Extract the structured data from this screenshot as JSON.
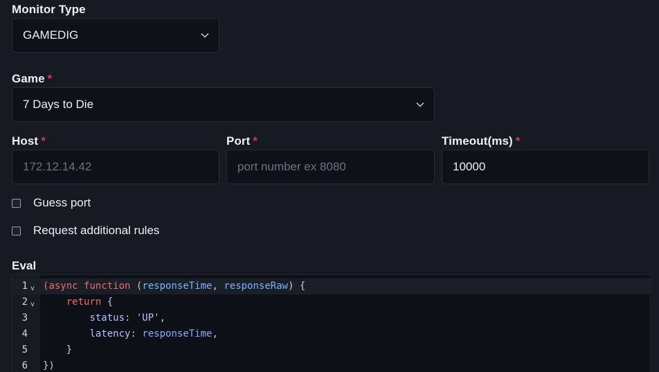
{
  "monitor_type": {
    "label": "Monitor Type",
    "value": "GAMEDIG"
  },
  "game": {
    "label": "Game",
    "required_mark": "*",
    "value": "7 Days to Die"
  },
  "host": {
    "label": "Host",
    "required_mark": "*",
    "placeholder": "172.12.14.42"
  },
  "port": {
    "label": "Port",
    "required_mark": "*",
    "placeholder": "port number ex 8080"
  },
  "timeout": {
    "label": "Timeout(ms)",
    "required_mark": "*",
    "value": "10000"
  },
  "guess_port": {
    "label": "Guess port",
    "checked": false
  },
  "request_rules": {
    "label": "Request additional rules",
    "checked": false
  },
  "eval": {
    "label": "Eval",
    "fold_marker": "v",
    "lines": [
      {
        "number": "1",
        "tokens": [
          {
            "t": "(",
            "c": "kw"
          },
          {
            "t": "async",
            "c": "kw"
          },
          {
            "t": " ",
            "c": "punc"
          },
          {
            "t": "function",
            "c": "kw"
          },
          {
            "t": " (",
            "c": "punc"
          },
          {
            "t": "responseTime",
            "c": "fn"
          },
          {
            "t": ", ",
            "c": "punc"
          },
          {
            "t": "responseRaw",
            "c": "fn"
          },
          {
            "t": ") {",
            "c": "punc"
          }
        ]
      },
      {
        "number": "2",
        "tokens": [
          {
            "t": "    ",
            "c": "punc"
          },
          {
            "t": "return",
            "c": "kw"
          },
          {
            "t": " {",
            "c": "punc"
          }
        ]
      },
      {
        "number": "3",
        "tokens": [
          {
            "t": "        ",
            "c": "punc"
          },
          {
            "t": "status",
            "c": "prop"
          },
          {
            "t": ": ",
            "c": "punc"
          },
          {
            "t": "'UP'",
            "c": "str"
          },
          {
            "t": ",",
            "c": "punc"
          }
        ]
      },
      {
        "number": "4",
        "tokens": [
          {
            "t": "        ",
            "c": "punc"
          },
          {
            "t": "latency",
            "c": "prop"
          },
          {
            "t": ": ",
            "c": "punc"
          },
          {
            "t": "responseTime",
            "c": "fn"
          },
          {
            "t": ",",
            "c": "punc"
          }
        ]
      },
      {
        "number": "5",
        "tokens": [
          {
            "t": "    }",
            "c": "punc"
          }
        ]
      },
      {
        "number": "6",
        "tokens": [
          {
            "t": "})",
            "c": "punc"
          }
        ]
      }
    ]
  },
  "icons": {
    "dropdown": "chevron-down-icon"
  },
  "colors": {
    "background": "#161a22",
    "input_background": "#0e1118",
    "required": "#dc3545",
    "keyword": "#ee6b6b",
    "identifier": "#7fb0ff",
    "property": "#b4c1ff"
  }
}
